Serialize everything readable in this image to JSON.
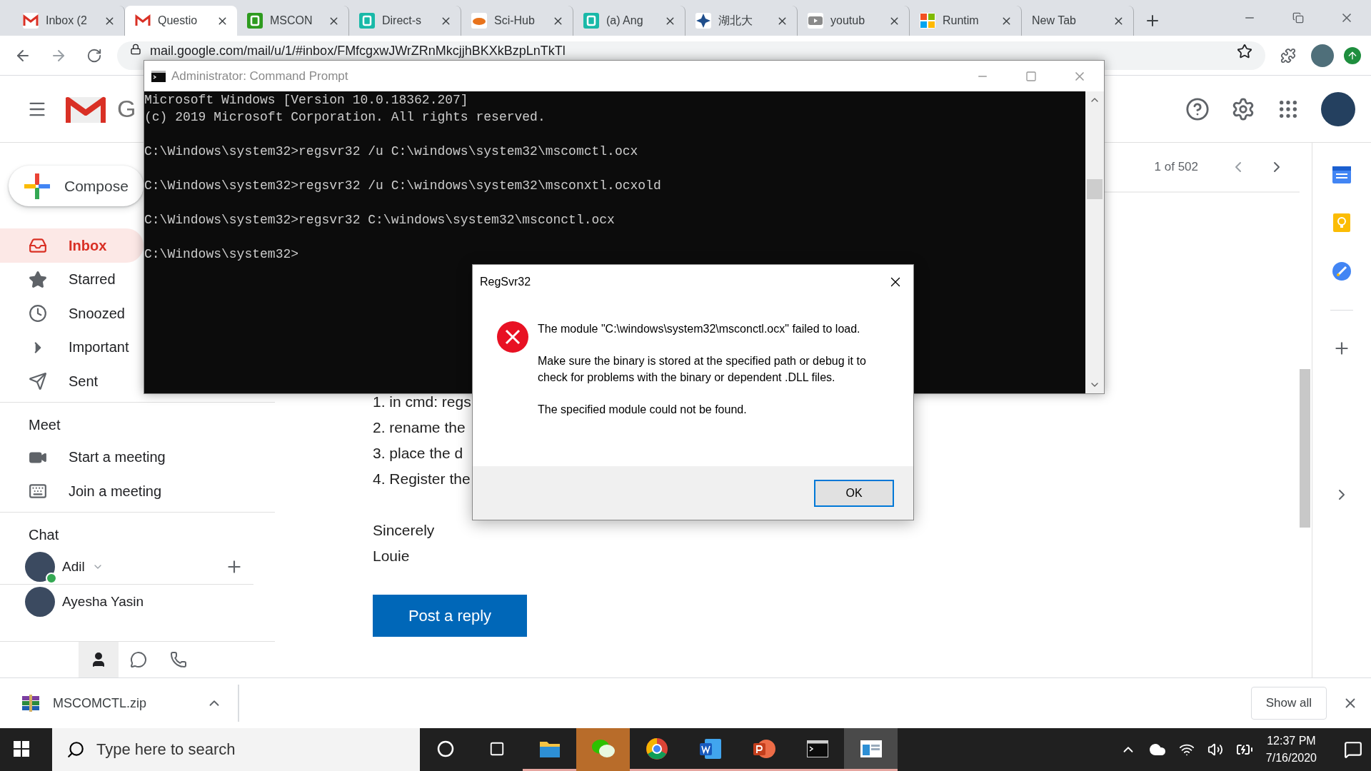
{
  "browser": {
    "tabs": [
      {
        "label": "Inbox (2",
        "selected": false
      },
      {
        "label": "Questio",
        "selected": true
      },
      {
        "label": "MSCON",
        "selected": false
      },
      {
        "label": "Direct-s",
        "selected": false
      },
      {
        "label": "Sci-Hub",
        "selected": false
      },
      {
        "label": "(a) Ang",
        "selected": false
      },
      {
        "label": "湖北大",
        "selected": false
      },
      {
        "label": "youtub",
        "selected": false
      },
      {
        "label": "Runtim",
        "selected": false
      },
      {
        "label": "New Tab",
        "selected": false
      }
    ],
    "address": "mail.google.com/mail/u/1/#inbox/FMfcgxwJWrZRnMkcjjhBKXkBzpLnTkTl"
  },
  "gmail": {
    "logo_text": "G",
    "compose": "Compose",
    "nav": [
      {
        "label": "Inbox",
        "selected": true
      },
      {
        "label": "Starred",
        "selected": false
      },
      {
        "label": "Snoozed",
        "selected": false
      },
      {
        "label": "Important",
        "selected": false
      },
      {
        "label": "Sent",
        "selected": false
      }
    ],
    "meet": {
      "heading": "Meet",
      "items": [
        "Start a meeting",
        "Join a meeting"
      ]
    },
    "chat": {
      "heading": "Chat",
      "contacts": [
        {
          "name": "Adil",
          "online": true
        },
        {
          "name": "Ayesha Yasin",
          "online": false
        }
      ],
      "tabs": [
        {
          "selected": true
        },
        {
          "selected": false
        },
        {
          "selected": false
        }
      ]
    },
    "pager": "1 of 502",
    "message": {
      "steps": [
        "1. in cmd: regs",
        "2. rename the",
        "3. place the d",
        "4. Register the"
      ],
      "closing": [
        "Sincerely",
        "Louie"
      ],
      "button": "Post a reply"
    }
  },
  "download_bar": {
    "file": "MSCOMCTL.zip",
    "button": "Show all"
  },
  "cmd_window": {
    "title": "Administrator: Command Prompt",
    "header": [
      "Microsoft Windows [Version 10.0.18362.207]",
      "(c) 2019 Microsoft Corporation. All rights reserved."
    ],
    "commands": [
      "C:\\Windows\\system32>regsvr32 /u C:\\windows\\system32\\mscomctl.ocx",
      "C:\\Windows\\system32>regsvr32 /u C:\\windows\\system32\\msconxtl.ocxold",
      "C:\\Windows\\system32>regsvr32 C:\\windows\\system32\\msconctl.ocx",
      "C:\\Windows\\system32>"
    ]
  },
  "dialog": {
    "title": "RegSvr32",
    "paragraphs": [
      "The module \"C:\\windows\\system32\\msconctl.ocx\" failed to load.",
      "Make sure the binary is stored at the specified path or debug it to check for problems with the binary or dependent .DLL files.",
      "The specified module could not be found."
    ],
    "button": "OK"
  },
  "taskbar": {
    "search": {
      "placeholder": "Type here to search"
    },
    "apps": [
      {
        "running": true,
        "flashing": false,
        "selected": false
      },
      {
        "running": false,
        "flashing": true,
        "selected": false
      },
      {
        "running": true,
        "flashing": false,
        "selected": false
      },
      {
        "running": true,
        "flashing": false,
        "selected": false
      },
      {
        "running": true,
        "flashing": false,
        "selected": false
      },
      {
        "running": true,
        "flashing": false,
        "selected": false
      },
      {
        "running": true,
        "flashing": false,
        "selected": true
      }
    ],
    "time": "12:37 PM",
    "date": "7/16/2020"
  }
}
